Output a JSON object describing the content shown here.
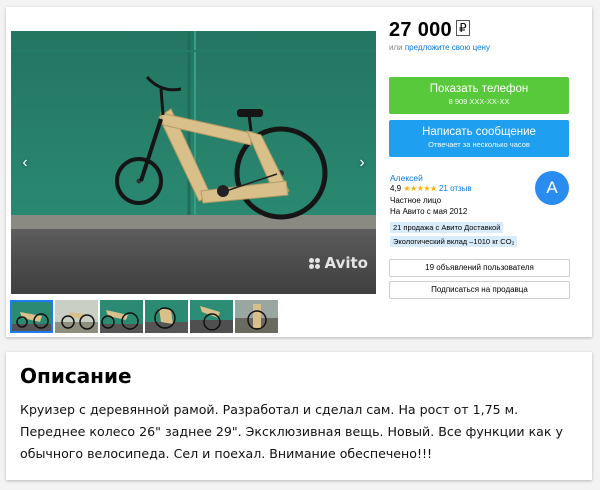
{
  "listing": {
    "price": "27 000",
    "currency_symbol": "₽",
    "offer_prefix": "или",
    "offer_link": "предложите свою цену"
  },
  "buttons": {
    "phone": {
      "label": "Показать телефон",
      "sublabel": "8 909 ХХХ-ХХ-ХХ",
      "color": "#58c93a"
    },
    "message": {
      "label": "Написать сообщение",
      "sublabel": "Отвечает за несколько часов",
      "color": "#1e9ff0"
    },
    "user_ads": "19 объявлений пользователя",
    "subscribe": "Подписаться на продавца"
  },
  "seller": {
    "name": "Алексей",
    "rating": "4,9",
    "stars": "★★★★★",
    "reviews": "21 отзыв",
    "type": "Частное лицо",
    "since": "На Авито с мая 2012",
    "avatar_letter": "А",
    "avatar_color": "#2b8cf0",
    "badges": [
      "21 продажа с Авито Доставкой",
      "Экологический вклад –1010 кг CO₂"
    ]
  },
  "gallery": {
    "watermark": "Avito",
    "prev_icon": "chevron-left-icon",
    "next_icon": "chevron-right-icon",
    "prev_glyph": "‹",
    "next_glyph": "›",
    "thumbnail_count": 6,
    "active_thumbnail": 1
  },
  "description": {
    "title": "Описание",
    "text": "Круизер с деревянной рамой. Разработал и сделал сам. На рост от 1,75 м. Переднее колесо 26\" заднее 29\". Эксклюзивная вещь. Новый. Все функции как у обычного велосипеда. Сел и поехал. Внимание обеспечено!!!"
  }
}
